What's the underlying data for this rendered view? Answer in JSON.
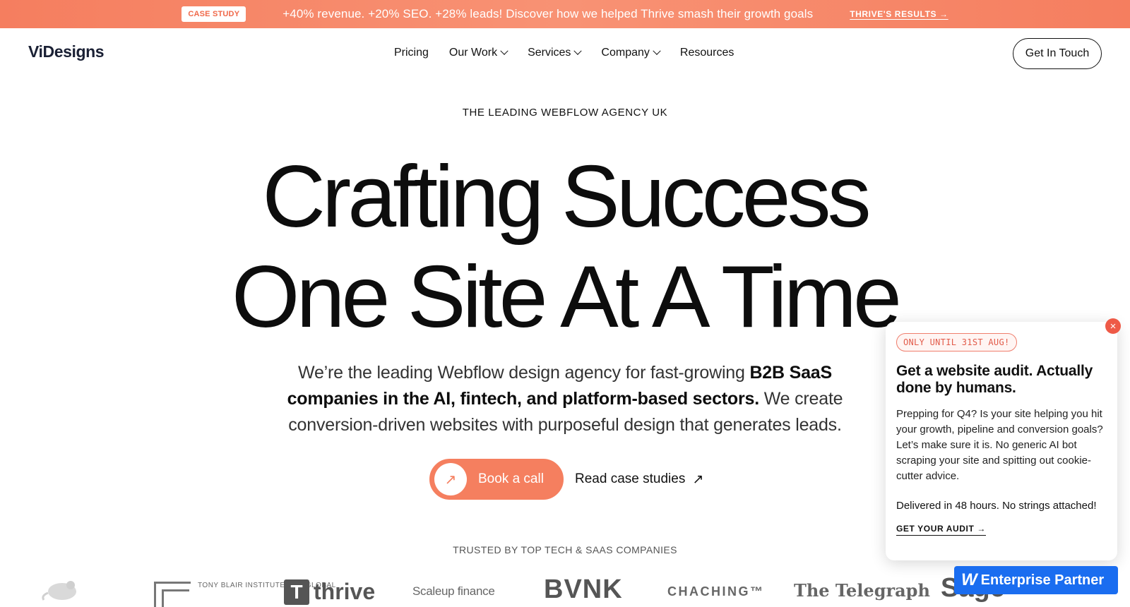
{
  "announcement": {
    "badge": "CASE STUDY",
    "text": "+40% revenue. +20% SEO. +28% leads! Discover how we helped Thrive smash their growth goals",
    "link": "THRIVE'S RESULTS →"
  },
  "nav": {
    "logo": "ViDesigns",
    "items": [
      {
        "label": "Pricing",
        "dropdown": false
      },
      {
        "label": "Our Work",
        "dropdown": true
      },
      {
        "label": "Services",
        "dropdown": true
      },
      {
        "label": "Company",
        "dropdown": true
      },
      {
        "label": "Resources",
        "dropdown": false
      }
    ],
    "cta": "Get In Touch"
  },
  "hero": {
    "eyebrow": "THE LEADING WEBFLOW AGENCY UK",
    "title_line1": "Crafting Success",
    "title_line2": "One Site At A Time",
    "subtitle_pre": "We’re the leading Webflow design agency for fast-growing ",
    "subtitle_bold": "B2B SaaS companies in the AI, fintech, and platform-based sectors.",
    "subtitle_post": " We create conversion-driven websites with purposeful design that generates leads.",
    "primary_cta": "Book a call",
    "secondary_cta": "Read case studies",
    "arrow_icon": "↗"
  },
  "trusted": {
    "heading": "TRUSTED BY TOP TECH & SAAS COMPANIES",
    "logos": {
      "tony_blair": "TONY BLAIR INSTITUTE FOR GLOBAL",
      "thrive_mark": "T",
      "thrive": "thrive",
      "scaleup": "Scaleup finance",
      "bvnk": "BVNK",
      "chaching": "CHACHING™",
      "telegraph": "The Telegraph",
      "sage": "Sage"
    }
  },
  "popup": {
    "close": "×",
    "tag": "ONLY UNTIL 31ST AUG!",
    "title": "Get a website audit. Actually done by humans.",
    "body": "Prepping for Q4? Is your site helping you hit your growth, pipeline and conversion goals? Let’s make sure it is. No generic AI bot scraping your site and spitting out cookie-cutter advice.",
    "body2": "Delivered in 48 hours. No strings attached!",
    "link": "GET YOUR AUDIT →"
  },
  "enterprise": {
    "mark": "W",
    "label": "Enterprise Partner"
  },
  "colors": {
    "accent": "#f57f5f",
    "webflow_blue": "#1a6df0",
    "close_red": "#ee5a47"
  }
}
